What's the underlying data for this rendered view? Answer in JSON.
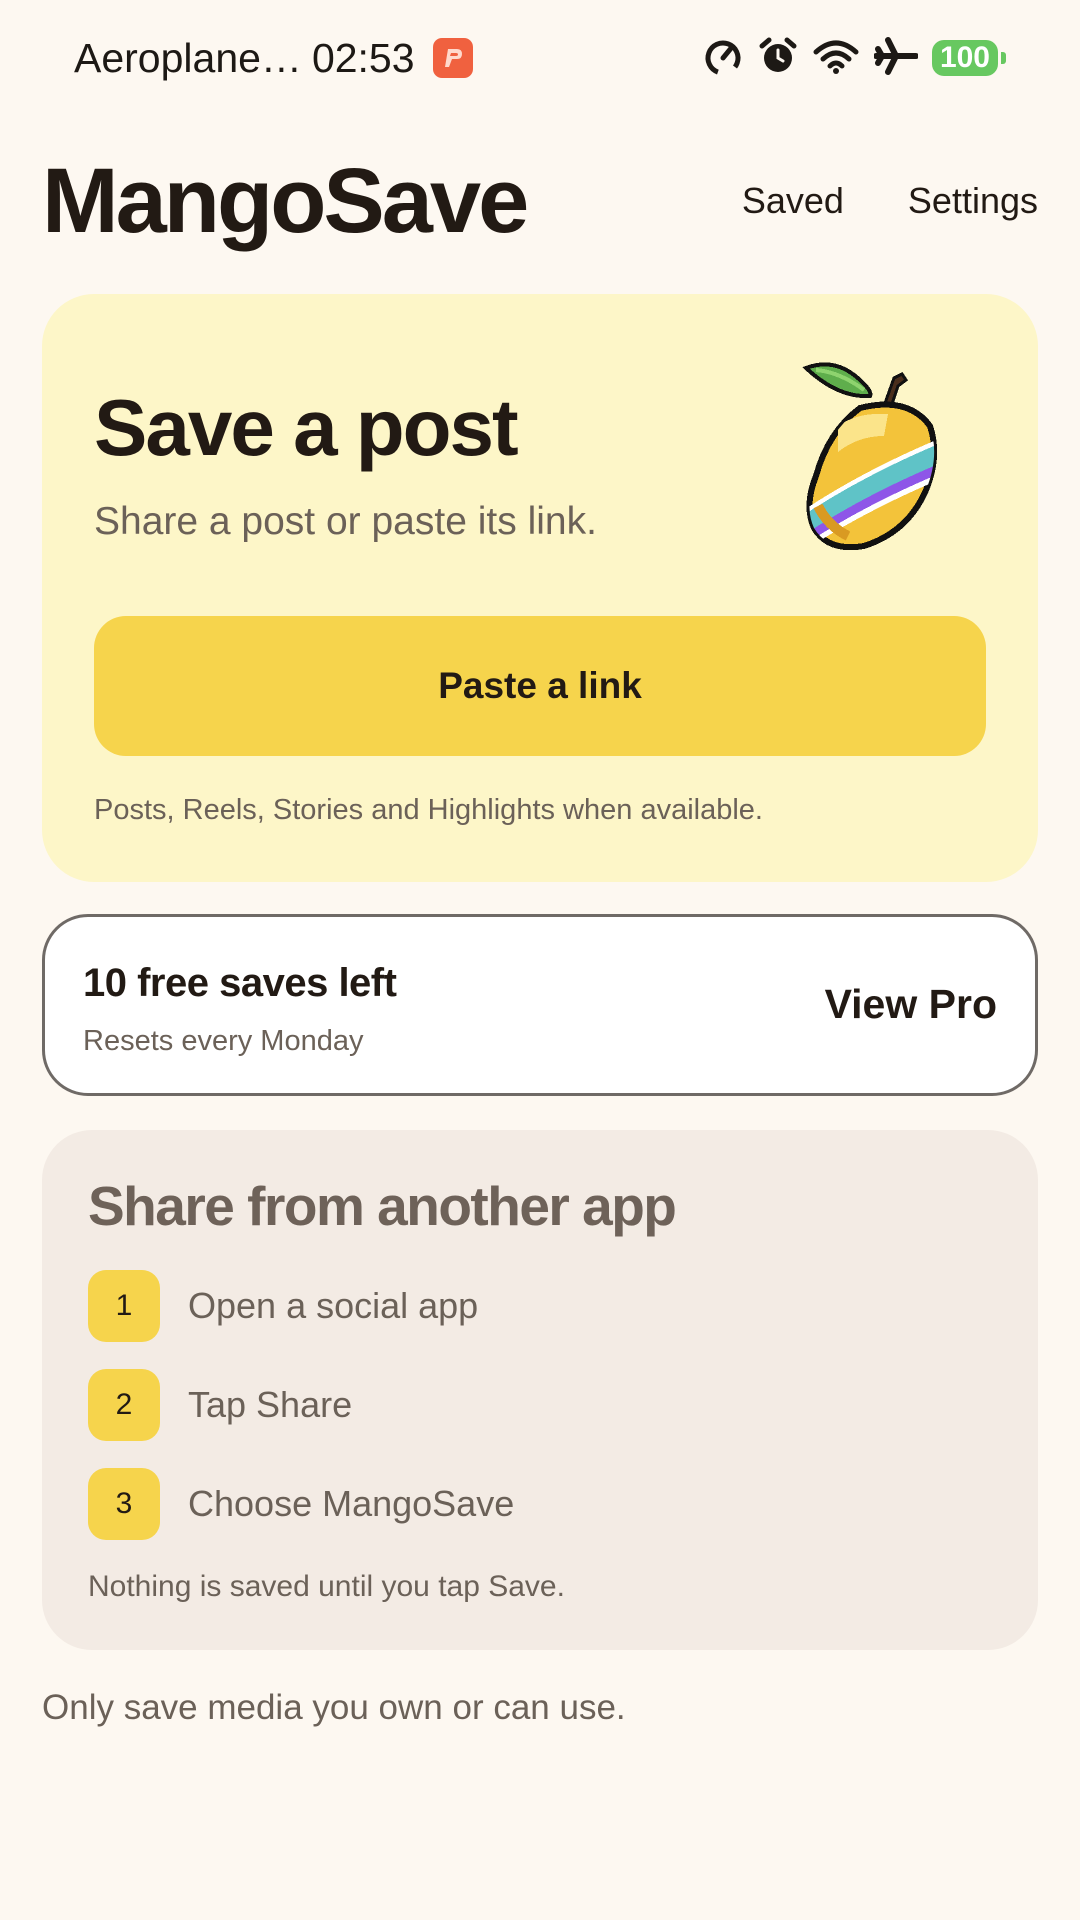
{
  "status_bar": {
    "carrier": "Aeroplane…",
    "time": "02:53",
    "battery": "100",
    "icons": [
      "app-notification-icon",
      "speedometer-icon",
      "alarm-icon",
      "wifi-icon",
      "airplane-icon",
      "battery-icon"
    ],
    "battery_color": "#67c860"
  },
  "header": {
    "title": "MangoSave",
    "nav": {
      "saved": "Saved",
      "settings": "Settings"
    }
  },
  "hero": {
    "title": "Save a post",
    "subtitle": "Share a post or paste its link.",
    "button": "Paste a link",
    "note": "Posts, Reels, Stories and Highlights when available.",
    "icon": "mango-icon",
    "background": "#fdf6c8",
    "accent": "#f6d44c"
  },
  "plan": {
    "count_text": "10 free saves left",
    "reset_text": "Resets every Monday",
    "action": "View Pro"
  },
  "share": {
    "title": "Share from another app",
    "steps": [
      {
        "number": "1",
        "text": "Open a social app"
      },
      {
        "number": "2",
        "text": "Tap Share"
      },
      {
        "number": "3",
        "text": "Choose MangoSave"
      }
    ],
    "note": "Nothing is saved until you tap Save.",
    "background": "#f3ebe4"
  },
  "footer": {
    "note": "Only save media you own or can use."
  }
}
